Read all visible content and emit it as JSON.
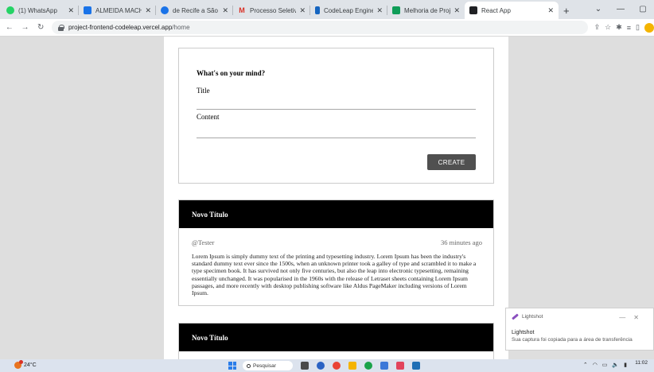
{
  "browser": {
    "tabs": [
      {
        "label": "(1) WhatsApp",
        "icon": "whatsapp-icon",
        "color": "#25d366",
        "active": false
      },
      {
        "label": "ALMEIDA MACHADO",
        "icon": "document-icon",
        "color": "#1a73e8",
        "active": false
      },
      {
        "label": "de Recife a São Paulo",
        "icon": "globe-icon",
        "color": "#1a73e8",
        "active": false
      },
      {
        "label": "Processo Seletivo Co:",
        "icon": "gmail-icon",
        "color": "#d93025",
        "active": false
      },
      {
        "label": "CodeLeap Engineerin",
        "icon": "bookmark-icon",
        "color": "#1565c0",
        "active": false
      },
      {
        "label": "Melhoria de Projeto",
        "icon": "page-icon",
        "color": "#0f9d58",
        "active": false
      },
      {
        "label": "React App",
        "icon": "react-icon",
        "color": "#202124",
        "active": true
      }
    ],
    "url": {
      "host": "project-frontend-codeleap.vercel.app",
      "path": "/home"
    }
  },
  "form": {
    "title": "What's on your mind?",
    "title_label": "Title",
    "content_label": "Content",
    "create_label": "CREATE"
  },
  "posts": [
    {
      "title": "Novo Título",
      "author": "@Tester",
      "time": "36 minutes ago",
      "body": "Lorem Ipsum is simply dummy text of the printing and typesetting industry. Lorem Ipsum has been the industry's standard dummy text ever since the 1500s, when an unknown printer took a galley of type and scrambled it to make a type specimen book. It has survived not only five centuries, but also the leap into electronic typesetting, remaining essentially unchanged. It was popularised in the 1960s with the release of Letraset sheets containing Lorem Ipsum passages, and more recently with desktop publishing software like Aldus PageMaker including versions of Lorem Ipsum."
    },
    {
      "title": "Novo Título"
    }
  ],
  "toast": {
    "app": "Lightshot",
    "title": "Lightshot",
    "message": "Sua captura foi copiada para a área de transferência"
  },
  "taskbar": {
    "weather": "24°C",
    "search_label": "Pesquisar",
    "time": "11:02"
  }
}
